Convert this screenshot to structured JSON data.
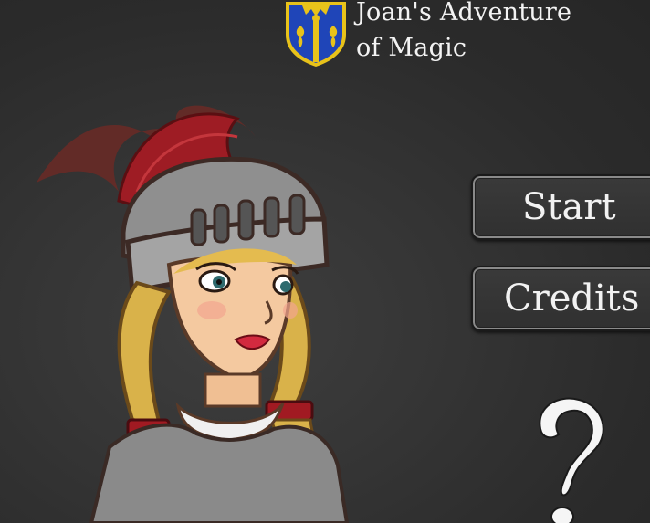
{
  "game": {
    "title_line1": "Joan's Adventure",
    "title_line2": "of Magic"
  },
  "menu": {
    "start_label": "Start",
    "credits_label": "Credits",
    "help_symbol": "?"
  },
  "colors": {
    "background": "#2e2e2e",
    "button_border": "#8a8a8a",
    "crest_blue": "#1f45b8",
    "crest_gold": "#e8c21a",
    "plume_red": "#a11a22",
    "helmet_gray": "#8e8e8e",
    "hair_blonde": "#d9b24a"
  },
  "icons": {
    "crest": "heraldic-shield-fleur-de-lis-icon",
    "help": "question-mark-icon"
  }
}
